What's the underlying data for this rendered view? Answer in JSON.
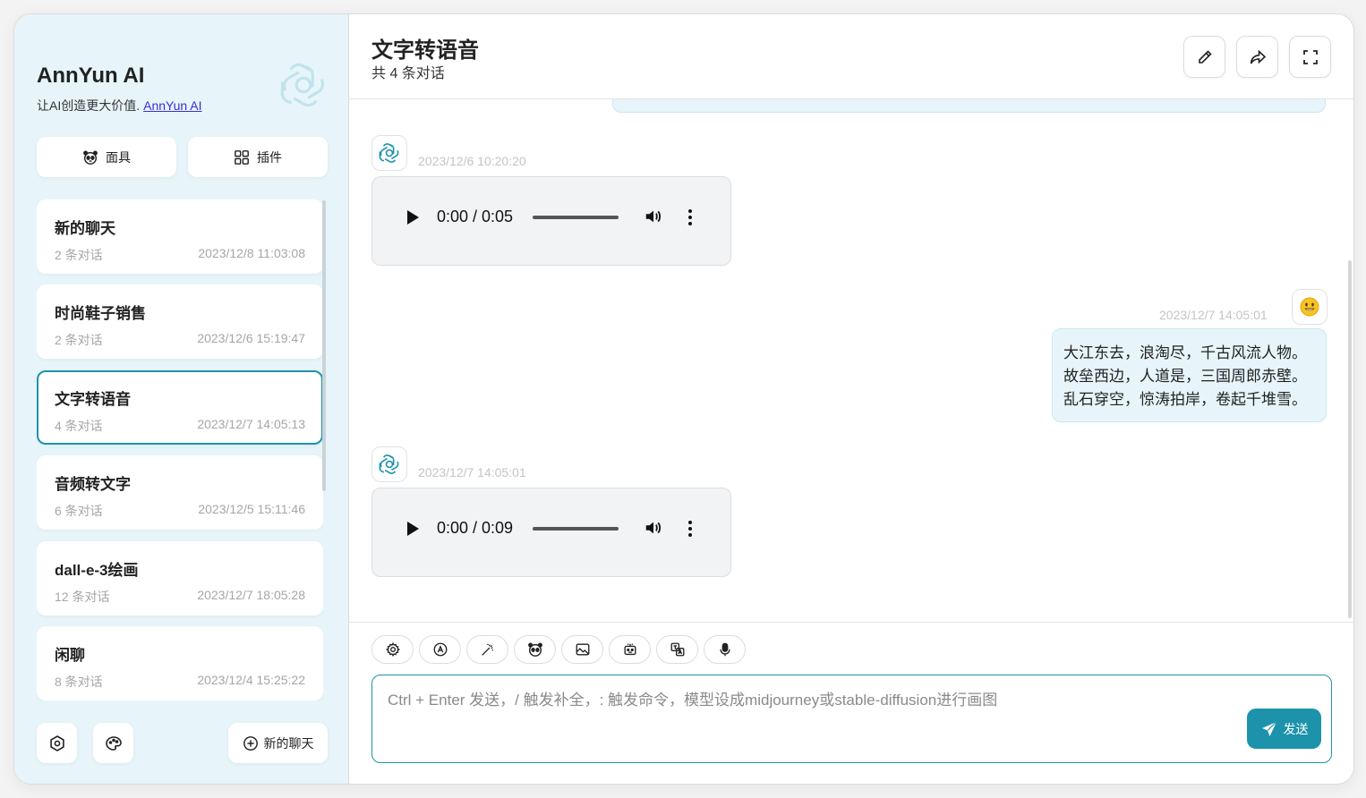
{
  "sidebar": {
    "brand": "AnnYun AI",
    "tagline": "让AI创造更大价值.",
    "tagline_link": "AnnYun AI",
    "mask_label": "面具",
    "plugin_label": "插件",
    "chats": [
      {
        "title": "新的聊天",
        "count": "2 条对话",
        "date": "2023/12/8 11:03:08",
        "active": false
      },
      {
        "title": "时尚鞋子销售",
        "count": "2 条对话",
        "date": "2023/12/6 15:19:47",
        "active": false
      },
      {
        "title": "文字转语音",
        "count": "4 条对话",
        "date": "2023/12/7 14:05:13",
        "active": true
      },
      {
        "title": "音频转文字",
        "count": "6 条对话",
        "date": "2023/12/5 15:11:46",
        "active": false
      },
      {
        "title": "dall-e-3绘画",
        "count": "12 条对话",
        "date": "2023/12/7 18:05:28",
        "active": false
      },
      {
        "title": "闲聊",
        "count": "8 条对话",
        "date": "2023/12/4 15:25:22",
        "active": false
      }
    ],
    "new_chat_label": "新的聊天"
  },
  "header": {
    "title": "文字转语音",
    "subtitle": "共 4 条对话"
  },
  "messages": [
    {
      "role": "assistant",
      "time": "2023/12/6 10:20:20",
      "audio_time": "0:00 / 0:05"
    },
    {
      "role": "user",
      "time": "2023/12/7 14:05:01",
      "lines": [
        "大江东去，浪淘尽，千古风流人物。",
        "故垒西边，人道是，三国周郎赤壁。",
        "乱石穿空，惊涛拍岸，卷起千堆雪。"
      ]
    },
    {
      "role": "assistant",
      "time": "2023/12/7 14:05:01",
      "audio_time": "0:00 / 0:09"
    }
  ],
  "input": {
    "placeholder": "Ctrl + Enter 发送，/ 触发补全，: 触发命令，模型设成midjourney或stable-diffusion进行画图",
    "send_label": "发送"
  },
  "colors": {
    "accent": "#1d93ab",
    "sidebar_bg": "#e7f5fb",
    "bubble_bg": "#e7f5fb"
  }
}
